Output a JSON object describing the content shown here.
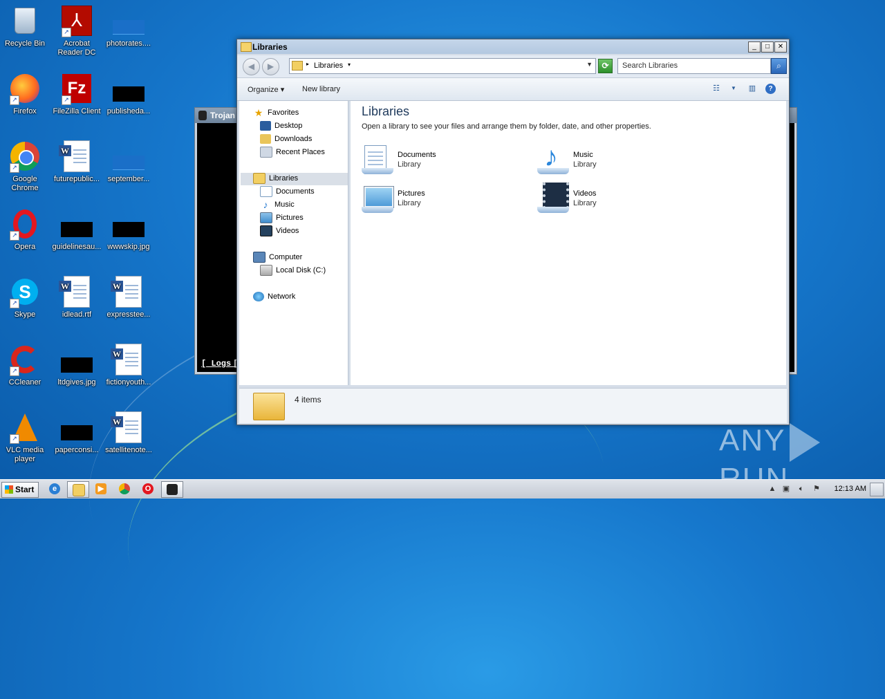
{
  "desktop": {
    "icons": [
      {
        "label": "Recycle Bin"
      },
      {
        "label": "Acrobat Reader DC"
      },
      {
        "label": "photorates...."
      },
      {
        "label": "Firefox"
      },
      {
        "label": "FileZilla Client"
      },
      {
        "label": "publisheda..."
      },
      {
        "label": "Google Chrome"
      },
      {
        "label": "futurepublic..."
      },
      {
        "label": "september..."
      },
      {
        "label": "Opera"
      },
      {
        "label": "guidelinesau..."
      },
      {
        "label": "wwwskip.jpg"
      },
      {
        "label": "Skype"
      },
      {
        "label": "idlead.rtf"
      },
      {
        "label": "expresstee..."
      },
      {
        "label": "CCleaner"
      },
      {
        "label": "ltdgives.jpg"
      },
      {
        "label": "fictionyouth..."
      },
      {
        "label": "VLC media player"
      },
      {
        "label": "paperconsi..."
      },
      {
        "label": "satellitenote..."
      }
    ]
  },
  "background_window": {
    "title": "Trojan",
    "logs_link": "[ Logs ]",
    "extra_link": "["
  },
  "explorer": {
    "title": "Libraries",
    "address": {
      "crumb": "Libraries"
    },
    "search": {
      "placeholder": "Search Libraries"
    },
    "toolbar": {
      "organize": "Organize",
      "new_library": "New library"
    },
    "nav": {
      "favorites": "Favorites",
      "desktop": "Desktop",
      "downloads": "Downloads",
      "recent_places": "Recent Places",
      "libraries": "Libraries",
      "documents": "Documents",
      "music": "Music",
      "pictures": "Pictures",
      "videos": "Videos",
      "computer": "Computer",
      "local_disk": "Local Disk (C:)",
      "network": "Network"
    },
    "content": {
      "heading": "Libraries",
      "subtitle": "Open a library to see your files and arrange them by folder, date, and other properties.",
      "libraries": [
        {
          "name": "Documents",
          "type": "Library"
        },
        {
          "name": "Music",
          "type": "Library"
        },
        {
          "name": "Pictures",
          "type": "Library"
        },
        {
          "name": "Videos",
          "type": "Library"
        }
      ]
    },
    "status": {
      "count": "4 items"
    }
  },
  "taskbar": {
    "start_label": "Start",
    "clock": "12:13 AM"
  },
  "watermark": {
    "left": "ANY",
    "right": "RUN"
  }
}
